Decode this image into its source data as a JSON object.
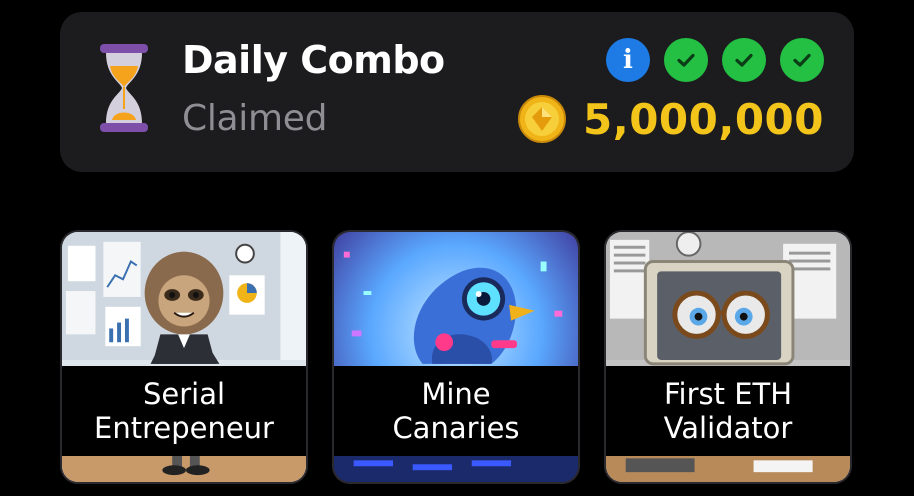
{
  "daily_combo": {
    "title": "Daily Combo",
    "status": "Claimed",
    "reward": "5,000,000",
    "icons": {
      "timer": "hourglass-icon",
      "info": "info-icon",
      "check": "check-icon",
      "coin": "coin-icon"
    },
    "info_glyph": "i",
    "found_count": 3,
    "colors": {
      "panel": "#1c1c1e",
      "reward": "#f3c41a",
      "status": "#8e8e93",
      "check": "#23c043",
      "info": "#1e7be6"
    }
  },
  "cards": [
    {
      "line1": "Serial",
      "line2": "Entrepeneur",
      "illustration": "sloth-businessman-in-office"
    },
    {
      "line1": "Mine",
      "line2": "Canaries",
      "illustration": "robot-canary"
    },
    {
      "line1": "First ETH",
      "line2": "Validator",
      "illustration": "computer-with-glasses"
    }
  ]
}
